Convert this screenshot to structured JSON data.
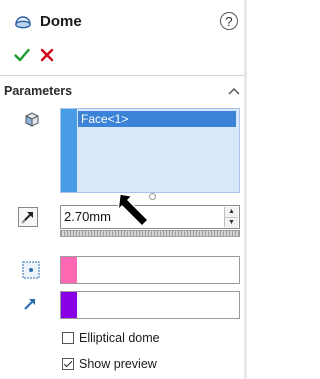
{
  "header": {
    "title": "Dome",
    "help_symbol": "?"
  },
  "actions": {
    "ok_icon": "checkmark-icon",
    "cancel_icon": "x-icon"
  },
  "parameters": {
    "section_title": "Parameters",
    "faces": [
      "Face<1>"
    ],
    "distance_value": "2.70mm",
    "elliptical_dome": {
      "label": "Elliptical dome",
      "checked": false
    },
    "show_preview": {
      "label": "Show preview",
      "checked": true
    }
  },
  "colors": {
    "face_strip": "#4a9be6",
    "constraint_point_swatch": "#ff69b4",
    "direction_swatch": "#8a00e6",
    "ok": "#1e9b2e",
    "cancel": "#d0021b"
  }
}
